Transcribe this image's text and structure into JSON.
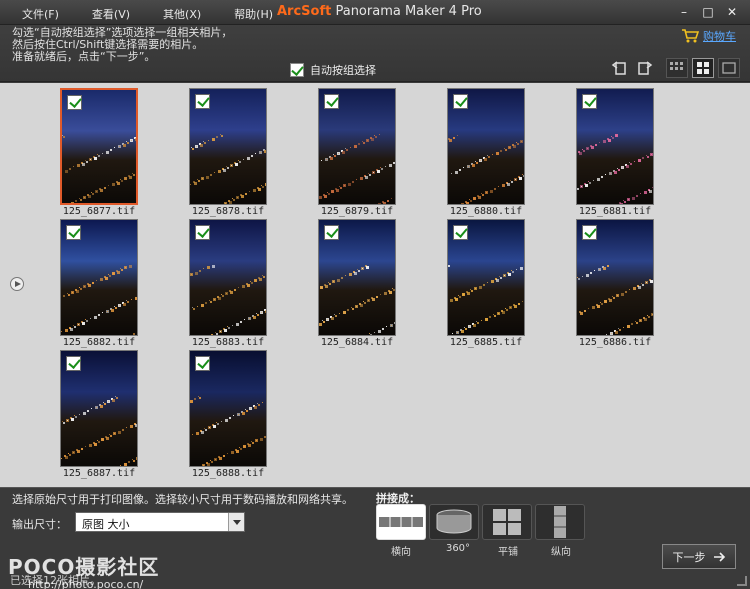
{
  "menu": [
    "文件(F)",
    "查看(V)",
    "其他(X)",
    "帮助(H)"
  ],
  "app_title": {
    "brand": "ArcSoft",
    "rest": " Panorama Maker 4 Pro"
  },
  "window_controls": {
    "minimize": "–",
    "maximize": "□",
    "close": "✕"
  },
  "instructions": [
    "勾选“自动按组选择”选项选择一组相关相片，",
    "然后按住Ctrl/Shift键选择需要的相片。",
    "准备就绪后，点击“下一步”。"
  ],
  "cart_label": "购物车",
  "auto_group_label": "自动按组选择",
  "thumbnails": [
    {
      "file": "125_6877.tif",
      "selected_frame": true
    },
    {
      "file": "125_6878.tif"
    },
    {
      "file": "125_6879.tif"
    },
    {
      "file": "125_6880.tif"
    },
    {
      "file": "125_6881.tif"
    },
    {
      "file": "125_6882.tif"
    },
    {
      "file": "125_6883.tif"
    },
    {
      "file": "125_6884.tif"
    },
    {
      "file": "125_6885.tif"
    },
    {
      "file": "125_6886.tif"
    },
    {
      "file": "125_6887.tif"
    },
    {
      "file": "125_6888.tif"
    }
  ],
  "hint": "选择原始尺寸用于打印图像。选择较小尺寸用于数码播放和网络共享。",
  "output_size_label": "输出尺寸：",
  "output_size_value": "原图 大小",
  "stitch_label": "拼接成：",
  "modes": [
    "横向",
    "360°",
    "平铺",
    "纵向"
  ],
  "next_label": "下一步",
  "status": "已选择12张相片。",
  "watermark": {
    "logo": "POCO摄影社区",
    "url": "http://photo.poco.cn/"
  }
}
